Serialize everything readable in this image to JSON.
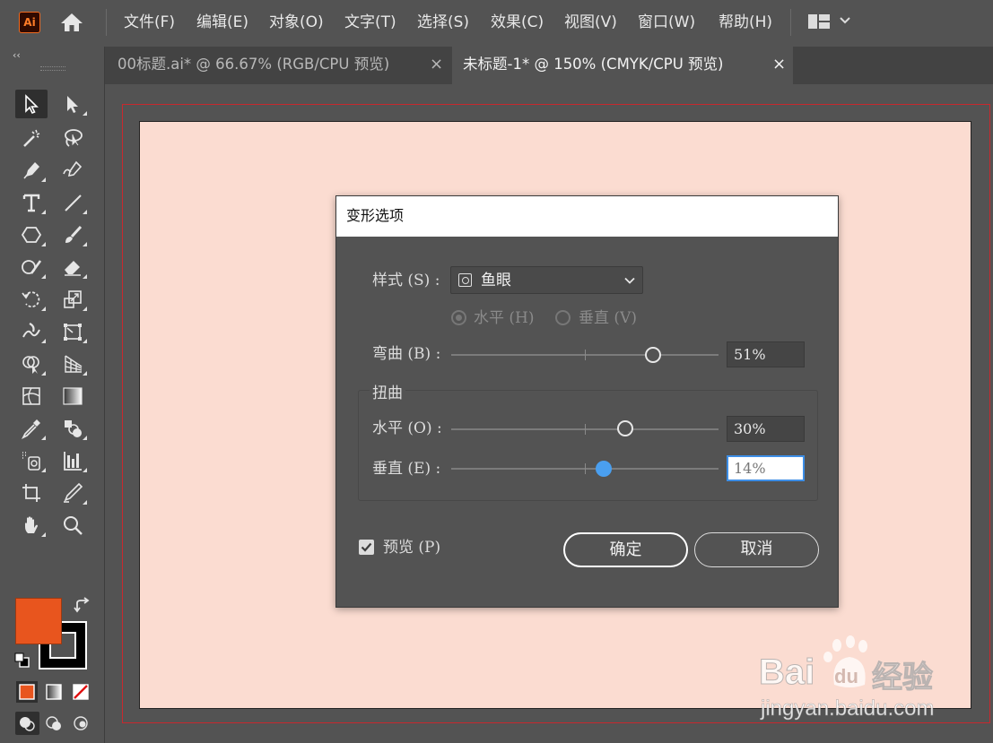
{
  "app": {
    "logo_text": "Ai",
    "menu": [
      "文件(F)",
      "编辑(E)",
      "对象(O)",
      "文字(T)",
      "选择(S)",
      "效果(C)",
      "视图(V)",
      "窗口(W)",
      "帮助(H)"
    ]
  },
  "tabs": [
    {
      "label": "00标题.ai* @ 66.67% (RGB/CPU 预览)",
      "close": "×",
      "active": false
    },
    {
      "label": "未标题-1* @ 150% (CMYK/CPU 预览)",
      "close": "×",
      "active": true
    }
  ],
  "toolbar": {
    "collapse_label": "‹‹",
    "fill_color": "#e8551e",
    "stroke_color": "#000000",
    "tools": [
      "selection-tool",
      "direct-selection-tool",
      "magic-wand-tool",
      "lasso-tool",
      "pen-tool",
      "curvature-tool",
      "type-tool",
      "line-segment-tool",
      "polygon-tool",
      "paintbrush-tool",
      "shaper-tool",
      "eraser-tool",
      "rotate-tool",
      "scale-tool",
      "warp-tool",
      "free-transform-tool",
      "shape-builder-tool",
      "perspective-grid-tool",
      "mesh-tool",
      "gradient-tool",
      "eyedropper-tool",
      "blend-tool",
      "symbol-sprayer-tool",
      "column-graph-tool",
      "artboard-tool",
      "slice-tool",
      "hand-tool",
      "zoom-tool"
    ]
  },
  "canvas": {
    "artboard_color": "#fbdcd1",
    "bleed_color": "#c8282e"
  },
  "dialog": {
    "title": "变形选项",
    "style_label": "样式 (S) :",
    "style_value": "鱼眼",
    "horizontal_radio": "水平 (H)",
    "vertical_radio": "垂直 (V)",
    "bend_label": "弯曲 (B) :",
    "bend_value": "51%",
    "bend_percent": 51,
    "distortion_group": "扭曲",
    "dist_h_label": "水平 (O) :",
    "dist_h_value": "30%",
    "dist_h_percent": 30,
    "dist_v_label": "垂直 (E) :",
    "dist_v_value": "14%",
    "dist_v_percent": 14,
    "preview_label": "预览 (P)",
    "preview_checked": true,
    "ok_label": "确定",
    "cancel_label": "取消",
    "accent_color": "#4a9fef"
  },
  "watermark": {
    "brand": "Bai",
    "brand_cn": "经验",
    "url": "jingyan.baidu.com"
  }
}
